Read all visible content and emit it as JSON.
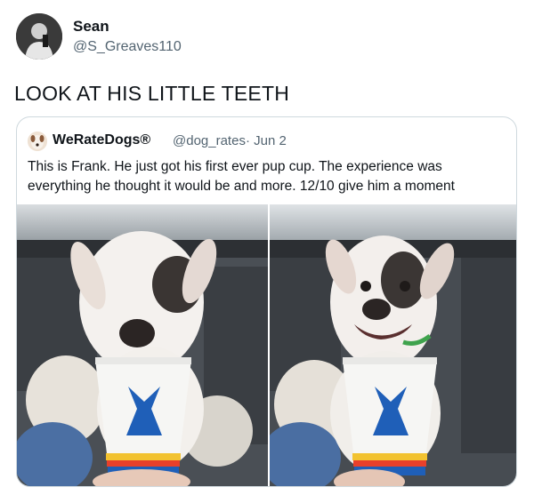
{
  "author": {
    "name": "Sean",
    "handle": "@S_Greaves110",
    "avatar_icon": "profile-photo"
  },
  "tweet_text": "LOOK AT HIS LITTLE TEETH",
  "quoted": {
    "name": "WeRateDogs®",
    "handle": "@dog_rates",
    "separator_date": "· Jun 2",
    "text": "This is Frank. He just got his first ever pup cup. The experience was everything he thought it would be and more. 12/10 give him a moment",
    "avatar_icon": "dog-profile-photo"
  },
  "colors": {
    "text_primary": "#0f1419",
    "text_secondary": "#536471",
    "border": "#cfd9de",
    "cup_logo_blue": "#1f5fb8"
  }
}
